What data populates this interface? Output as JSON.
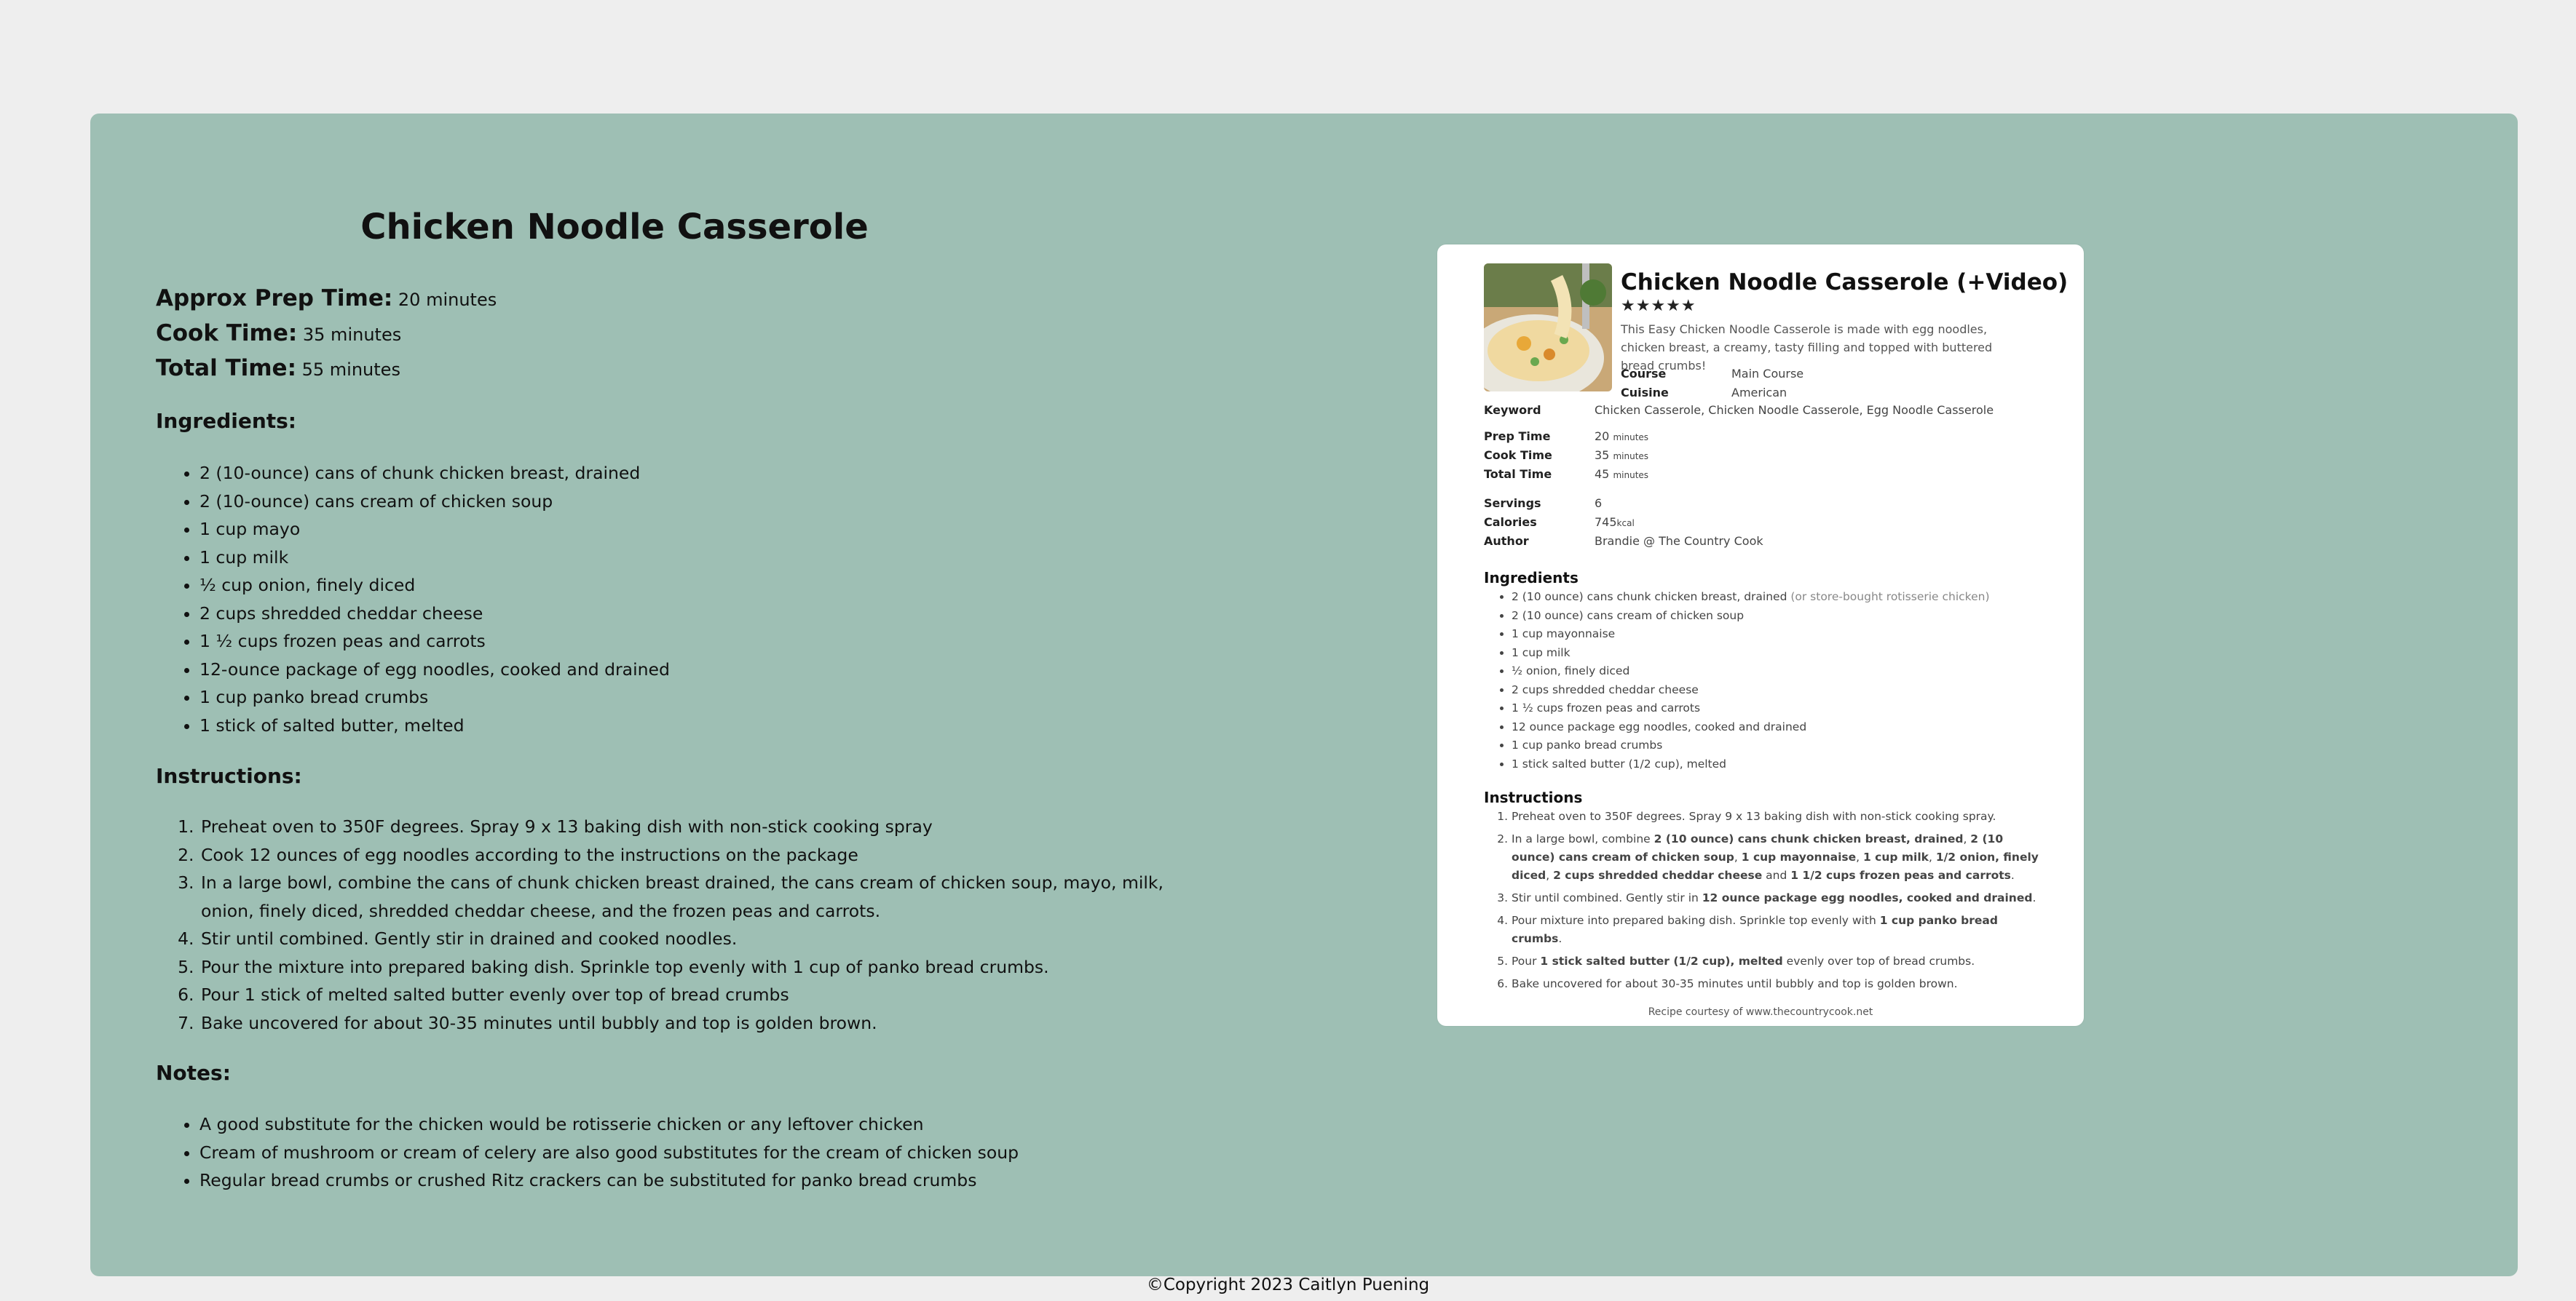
{
  "recipe": {
    "title": "Chicken Noodle Casserole",
    "prep_label": "Approx Prep Time:",
    "prep_value": "20 minutes",
    "cook_label": "Cook Time:",
    "cook_value": "35 minutes",
    "total_label": "Total Time:",
    "total_value": "55 minutes",
    "ingredients_heading": "Ingredients:",
    "ingredients": [
      "2 (10-ounce) cans of chunk chicken breast, drained",
      "2 (10-ounce) cans cream of chicken soup",
      "1 cup mayo",
      "1 cup milk",
      "½ cup onion, finely diced",
      "2 cups shredded cheddar cheese",
      "1 ½ cups frozen peas and carrots",
      "12-ounce package of egg noodles, cooked and drained",
      "1 cup panko bread crumbs",
      "1 stick of salted butter, melted"
    ],
    "instructions_heading": "Instructions:",
    "instructions": [
      "Preheat oven to 350F degrees. Spray 9 x 13 baking dish with non-stick cooking spray",
      "Cook 12 ounces of egg noodles according to the instructions on the package",
      "In a large bowl, combine the cans of chunk chicken breast drained, the cans cream of chicken soup, mayo, milk, onion, finely diced, shredded cheddar cheese, and the frozen peas and carrots.",
      "Stir until combined. Gently stir in drained and cooked noodles.",
      "Pour the mixture into prepared baking dish. Sprinkle top evenly with 1 cup of panko bread crumbs.",
      "Pour 1 stick of melted salted butter evenly over top of bread crumbs",
      "Bake uncovered for about 30-35 minutes until bubbly and top is golden brown."
    ],
    "notes_heading": "Notes:",
    "notes": [
      "A good substitute for the chicken would be rotisserie chicken or any leftover chicken",
      "Cream of mushroom or cream of celery are also good substitutes for the cream of chicken soup",
      "Regular bread crumbs or crushed Ritz crackers can be substituted for panko bread crumbs"
    ]
  },
  "card": {
    "title": "Chicken Noodle Casserole (+Video)",
    "stars": "★★★★★",
    "description": "This Easy Chicken Noodle Casserole is made with egg noodles, chicken breast, a creamy, tasty filling and topped with buttered bread crumbs!",
    "course_label": "Course",
    "course_value": "Main Course",
    "cuisine_label": "Cuisine",
    "cuisine_value": "American",
    "keyword_label": "Keyword",
    "keyword_value": "Chicken Casserole, Chicken Noodle Casserole, Egg Noodle Casserole",
    "prep_label": "Prep Time",
    "prep_num": "20",
    "cook_label": "Cook Time",
    "cook_num": "35",
    "total_label": "Total Time",
    "total_num": "45",
    "minutes_unit": "minutes",
    "servings_label": "Servings",
    "servings_value": "6",
    "calories_label": "Calories",
    "calories_num": "745",
    "calories_unit": "kcal",
    "author_label": "Author",
    "author_value": "Brandie @ The Country Cook",
    "ingredients_heading": "Ingredients",
    "ingredients": [
      "2 (10 ounce) cans chunk chicken breast, drained",
      "2 (10 ounce) cans cream of chicken soup",
      "1 cup mayonnaise",
      "1 cup milk",
      "½ onion, finely diced",
      "2 cups shredded cheddar cheese",
      "1 ½ cups frozen peas and carrots",
      "12 ounce package egg noodles, cooked and drained",
      "1 cup panko bread crumbs",
      "1 stick salted butter (1/2 cup), melted"
    ],
    "ingredient_note": "(or store-bought rotisserie chicken)",
    "instructions_heading": "Instructions",
    "step1": "Preheat oven to 350F degrees. Spray 9 x 13 baking dish with non-stick cooking spray.",
    "step2_a": "In a large bowl, combine ",
    "step2_b": "2 (10 ounce) cans chunk chicken breast, drained",
    "step2_c": ", ",
    "step2_d": "2 (10 ounce) cans cream of chicken soup",
    "step2_e": ", ",
    "step2_f": "1 cup mayonnaise",
    "step2_g": ", ",
    "step2_h": "1 cup milk",
    "step2_i": ", ",
    "step2_j": "1/2 onion, finely diced",
    "step2_k": ", ",
    "step2_l": "2 cups shredded cheddar cheese",
    "step2_m": " and ",
    "step2_n": "1 1/2 cups frozen peas and carrots",
    "step2_o": ".",
    "step3_a": "Stir until combined. Gently stir in ",
    "step3_b": "12 ounce package egg noodles, cooked and drained",
    "step3_c": ".",
    "step4_a": "Pour mixture into prepared baking dish. Sprinkle top evenly with ",
    "step4_b": "1 cup panko bread crumbs",
    "step4_c": ".",
    "step5_a": "Pour ",
    "step5_b": "1 stick salted butter (1/2 cup), melted",
    "step5_c": " evenly over top of bread crumbs.",
    "step6": "Bake uncovered for about 30-35 minutes until bubbly and top is golden brown.",
    "footer": "Recipe courtesy of www.thecountrycook.net"
  },
  "footer": {
    "copyright": "©Copyright 2023 Caitlyn Puening"
  }
}
